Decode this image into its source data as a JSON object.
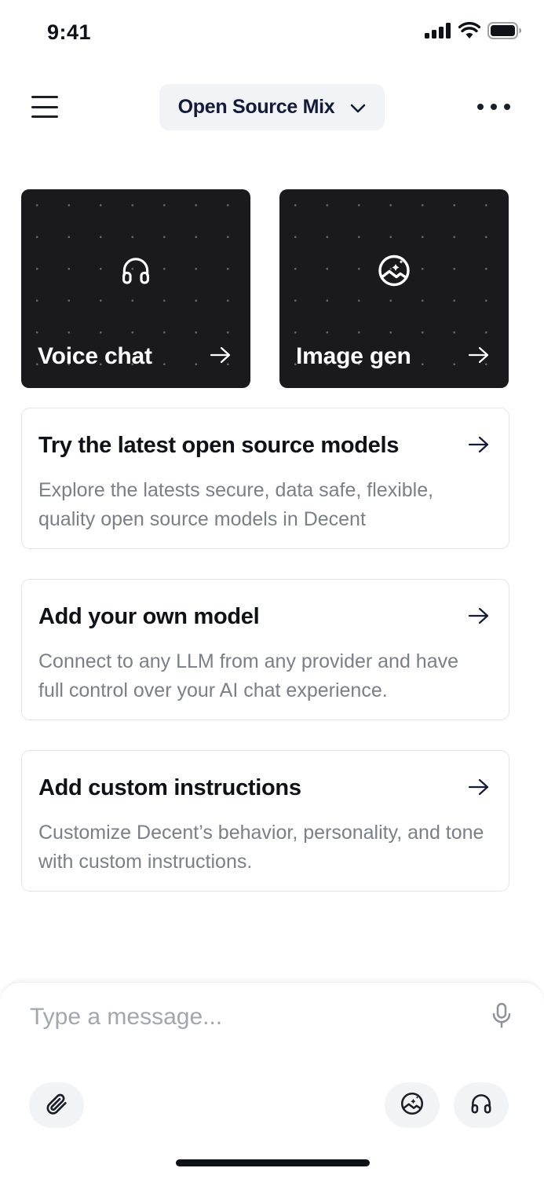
{
  "status_bar": {
    "time": "9:41",
    "icons": [
      "signal-icon",
      "wifi-icon",
      "battery-icon"
    ]
  },
  "header": {
    "model_selector": {
      "label": "Open Source Mix",
      "icon": "chevron-down-icon"
    },
    "menu_icon": "hamburger-menu-icon",
    "more_icon": "more-horizontal-icon"
  },
  "quick_actions": [
    {
      "label": "Voice chat",
      "icon": "headphones-icon"
    },
    {
      "label": "Image gen",
      "icon": "image-sparkle-icon"
    }
  ],
  "cards": [
    {
      "title": "Try the latest open source models",
      "description": "Explore the latests secure, data safe, flexible, quality open source models in Decent"
    },
    {
      "title": "Add your own model",
      "description": "Connect to any LLM from any provider and have full control over your AI chat experience."
    },
    {
      "title": "Add custom instructions",
      "description": "Customize Decent’s behavior, personality, and tone with custom instructions."
    }
  ],
  "composer": {
    "placeholder": "Type a message...",
    "value": "",
    "icons": [
      "microphone-icon",
      "paperclip-icon",
      "image-sparkle-icon",
      "headphones-icon"
    ]
  },
  "colors": {
    "tile_background": "#1a1a1c",
    "accent_text": "#131a3a",
    "muted_text": "#7a7f88",
    "chip_background": "#f2f3f5"
  }
}
